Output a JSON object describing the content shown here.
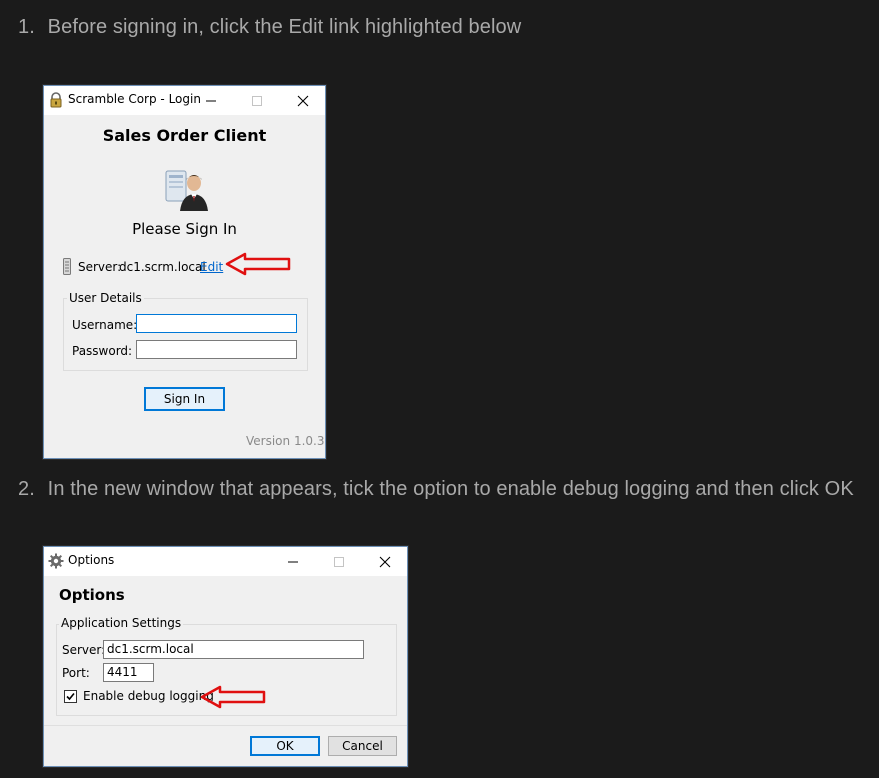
{
  "steps": [
    {
      "num": "1.",
      "text": "Before signing in, click the Edit link highlighted below"
    },
    {
      "num": "2.",
      "text": "In the new window that appears, tick the option to enable debug logging and then click OK"
    }
  ],
  "login_window": {
    "title": "Scramble Corp - Login",
    "heading": "Sales Order Client",
    "subheading": "Please Sign In",
    "server_label": "Server:",
    "server_value": "dc1.scrm.local",
    "edit_link": "Edit",
    "group_title": "User Details",
    "username_label": "Username:",
    "username_value": "",
    "password_label": "Password:",
    "password_value": "",
    "sign_in_button": "Sign In",
    "version": "Version 1.0.3"
  },
  "options_window": {
    "title": "Options",
    "heading": "Options",
    "group_title": "Application Settings",
    "server_label": "Server:",
    "server_value": "dc1.scrm.local",
    "port_label": "Port:",
    "port_value": "4411",
    "debug_label": "Enable debug logging",
    "debug_checked": true,
    "ok_button": "OK",
    "cancel_button": "Cancel"
  },
  "colors": {
    "page_background": "#1b1b1b",
    "step_text": "#a9a9a9",
    "arrow_red": "#e01010",
    "link_blue": "#0066cc",
    "focus_blue": "#0078d7"
  },
  "icons": [
    "lock-icon",
    "minimize-icon",
    "maximize-icon",
    "close-icon",
    "user-login-icon",
    "server-icon",
    "gear-icon",
    "checkbox-checked-icon",
    "red-arrow-icon"
  ]
}
